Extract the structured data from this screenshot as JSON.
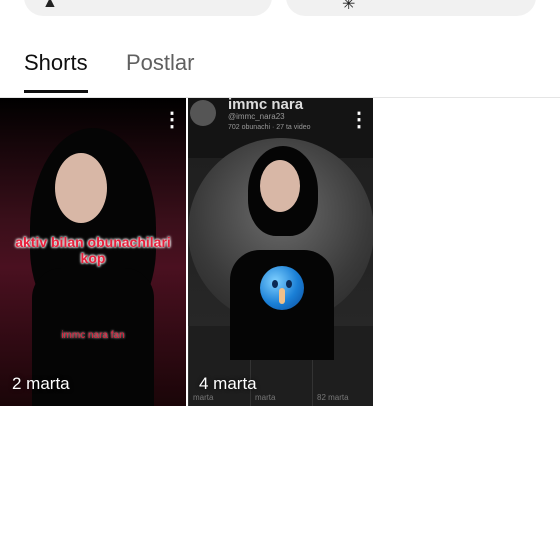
{
  "tabs": {
    "shorts_label": "Shorts",
    "posts_label": "Postlar"
  },
  "cards": [
    {
      "overlay_text": "aktiv bilan obunachilari kop",
      "overlay_small": "immc nara fan",
      "date": "2 marta"
    },
    {
      "bg_name": "immc nara",
      "bg_handle": "@immc_nara23",
      "bg_stats": "702 obunachi · 27 ta video",
      "date": "4 marta",
      "grid_labels": [
        "marta",
        "marta",
        "82 marta"
      ]
    }
  ],
  "icons": {
    "menu": "more-vert-icon",
    "top_left": "bell-icon",
    "top_right": "sparkle-icon"
  },
  "colors": {
    "accent_text": "#e8203c",
    "active_tab": "#0f0f0f",
    "inactive_tab": "#606060"
  }
}
